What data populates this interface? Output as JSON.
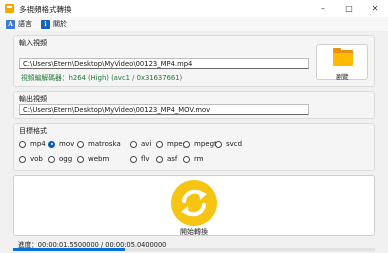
{
  "window": {
    "title": "多視頻格式轉換",
    "app_icon": "video-converter-icon",
    "controls": [
      "minimize-icon",
      "maximize-icon",
      "close-icon"
    ]
  },
  "menu": {
    "items": [
      {
        "label": "語言",
        "icon": "language-icon",
        "icon_text": "A",
        "color": "#3a7bd5"
      },
      {
        "label": "關於",
        "icon": "info-icon",
        "icon_text": "i",
        "color": "#1565c0"
      }
    ]
  },
  "input_section": {
    "title": "輸入視頻",
    "path": "C:\\Users\\Etern\\Desktop\\MyVideo\\00123_MP4.mp4",
    "codec_info": "視頻編解碼器：h264 (High) (avc1 / 0x31637661)",
    "codec_color": "#1e7d32",
    "browse_label": "瀏覽",
    "browse_icon": "folder-icon"
  },
  "output_section": {
    "title": "輸出視頻",
    "path": "C:\\Users\\Etern\\Desktop\\MyVideo\\00123_MP4_MOV.mov"
  },
  "format_section": {
    "title": "目標格式",
    "selected": "mov",
    "row1": [
      "mp4",
      "mov",
      "matroska",
      "avi",
      "mpeg",
      "mpegts",
      "svcd"
    ],
    "row2": [
      "vob",
      "ogg",
      "webm",
      "flv",
      "asf",
      "rm"
    ]
  },
  "convert": {
    "label": "開始轉換",
    "icon": "convert-refresh-icon",
    "color": "#f6c413"
  },
  "progress": {
    "text": "進度：00:00:01.5500000 / 00:00:05.0400000",
    "fraction": 0.31,
    "color": "#0a70d6"
  }
}
